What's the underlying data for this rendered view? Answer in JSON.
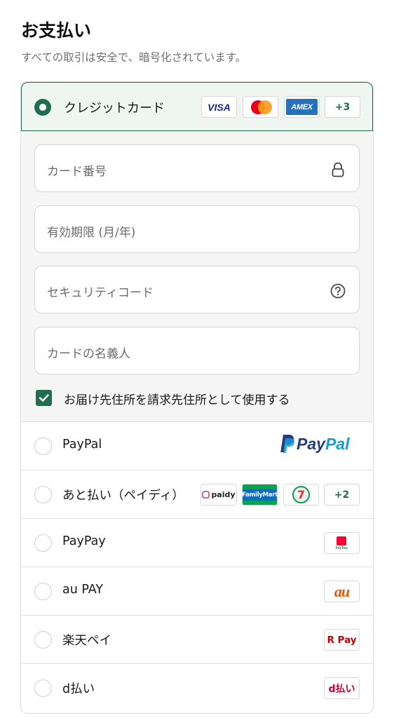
{
  "header": {
    "title": "お支払い",
    "subtitle": "すべての取引は安全で、暗号化されています。"
  },
  "credit_card": {
    "label": "クレジットカード",
    "brands": {
      "visa": "VISA",
      "amex": "AMEX",
      "more": "+3"
    },
    "fields": {
      "card_number": "カード番号",
      "expiry": "有効期限 (月/年)",
      "security_code": "セキュリティコード",
      "cardholder": "カードの名義人"
    },
    "billing_same": "お届け先住所を請求先住所として使用する"
  },
  "methods": [
    {
      "label": "PayPal",
      "logo_a": "Pay",
      "logo_b": "Pal"
    },
    {
      "label": "あと払い（ペイディ）",
      "paidy": "paidy",
      "famima": "FamilyMart",
      "seven": "7",
      "more": "+2"
    },
    {
      "label": "PayPay",
      "logo_sub": "PayPay"
    },
    {
      "label": "au PAY",
      "logo": "au"
    },
    {
      "label": "楽天ペイ",
      "logo": "R Pay"
    },
    {
      "label": "d払い",
      "logo": "d払い"
    }
  ],
  "colors": {
    "accent": "#1f6e4f",
    "selected_bg": "#eff5f1",
    "subtitle": "#707070"
  }
}
